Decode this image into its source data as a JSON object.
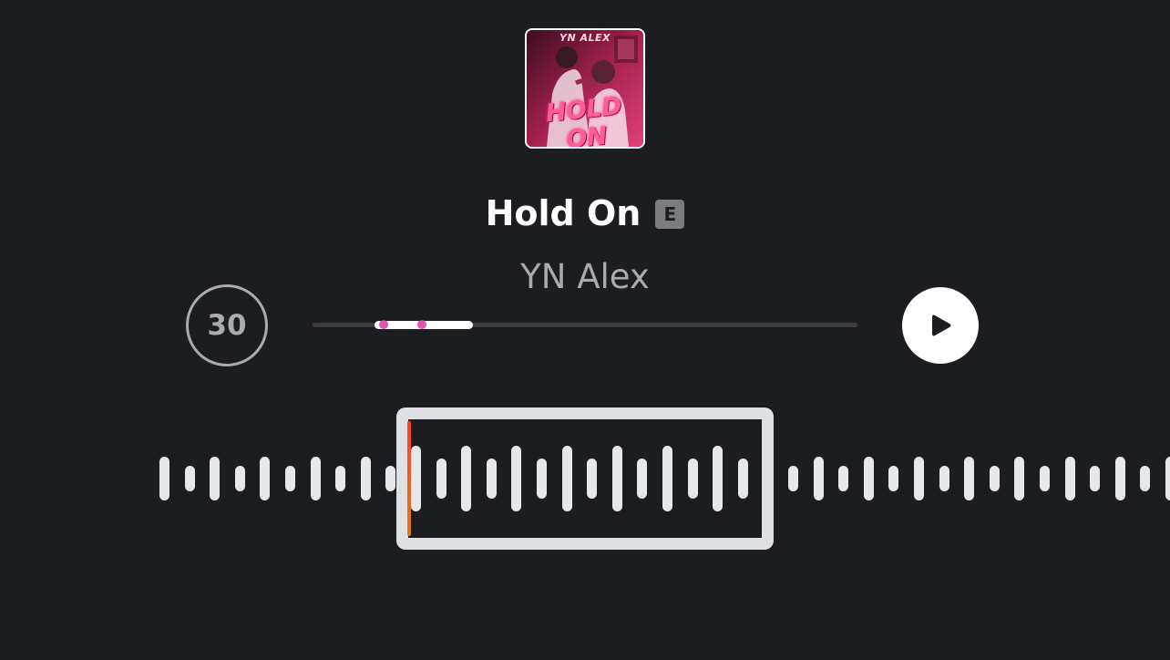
{
  "album_art": {
    "brand_text": "YN ALEX",
    "title_text": "HOLD ON"
  },
  "song": {
    "title": "Hold On",
    "explicit_badge": "E",
    "artist": "YN Alex"
  },
  "controls": {
    "skip_label": "30",
    "play_icon": "play-icon"
  },
  "progress": {
    "fill_start_fraction": 0.113,
    "fill_end_fraction": 0.294,
    "marker_fractions": [
      0.13,
      0.2
    ]
  },
  "waveform": {
    "bar_count": 41
  },
  "colors": {
    "background": "#1c1d21",
    "accent_marker": "#d63aa6",
    "playhead": "#ff3d2e",
    "secondary_text": "#a9abb0"
  }
}
